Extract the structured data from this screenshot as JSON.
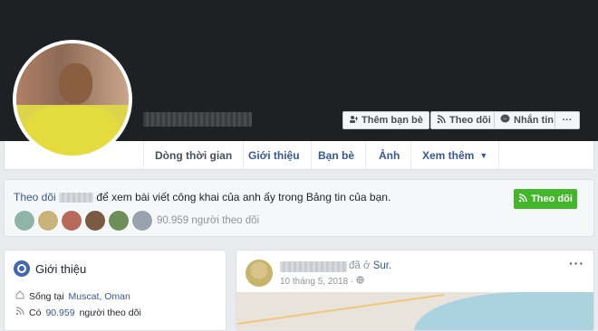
{
  "cover": {
    "buttons": [
      {
        "label": "Thêm bạn bè",
        "icon": "add-friend-icon"
      },
      {
        "label": "Theo dõi",
        "icon": "rss-icon"
      },
      {
        "label": "Nhắn tin",
        "icon": "messenger-icon"
      },
      {
        "label": "···",
        "icon": "more-icon"
      }
    ]
  },
  "tabs": [
    "Dòng thời gian",
    "Giới thiệu",
    "Bạn bè",
    "Ảnh",
    "Xem thêm"
  ],
  "follow_box": {
    "prefix": "Theo dõi",
    "suffix": "để xem bài viết công khai của anh ấy trong Bảng tin của bạn.",
    "button_label": "Theo dõi",
    "followers": "90.959 người theo dõi"
  },
  "intro": {
    "title": "Giới thiệu",
    "lives_prefix": "Sống tại",
    "lives_place": "Muscat, Oman",
    "followers_prefix": "Có",
    "followers_count": "90.959",
    "followers_suffix": "người theo dõi"
  },
  "post": {
    "location_prefix": "đã ở",
    "location": "Sur.",
    "date": "10 tháng 5, 2018 ·",
    "more": "···"
  },
  "colors": {
    "link": "#365899",
    "follow_green": "#42b72a",
    "cover": "#1f2023"
  }
}
